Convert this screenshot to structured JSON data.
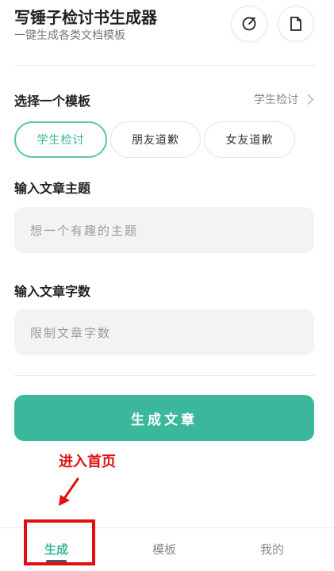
{
  "header": {
    "title": "写锤子检讨书生成器",
    "subtitle": "一键生成各类文档模板"
  },
  "template_section": {
    "label": "选择一个模板",
    "selected": "学生检讨",
    "chips": [
      {
        "label": "学生检讨",
        "active": true
      },
      {
        "label": "朋友道歉",
        "active": false
      },
      {
        "label": "女友道歉",
        "active": false
      }
    ]
  },
  "topic_section": {
    "label": "输入文章主题",
    "placeholder": "想一个有趣的主题"
  },
  "length_section": {
    "label": "输入文章字数",
    "placeholder": "限制文章字数"
  },
  "generate_button": {
    "label": "生成文章"
  },
  "annotation": {
    "text": "进入首页"
  },
  "tabbar": {
    "tabs": [
      {
        "label": "生成",
        "active": true
      },
      {
        "label": "模板",
        "active": false
      },
      {
        "label": "我的",
        "active": false
      }
    ]
  },
  "colors": {
    "accent": "#3bb89b",
    "annotation_red": "#e01010"
  }
}
